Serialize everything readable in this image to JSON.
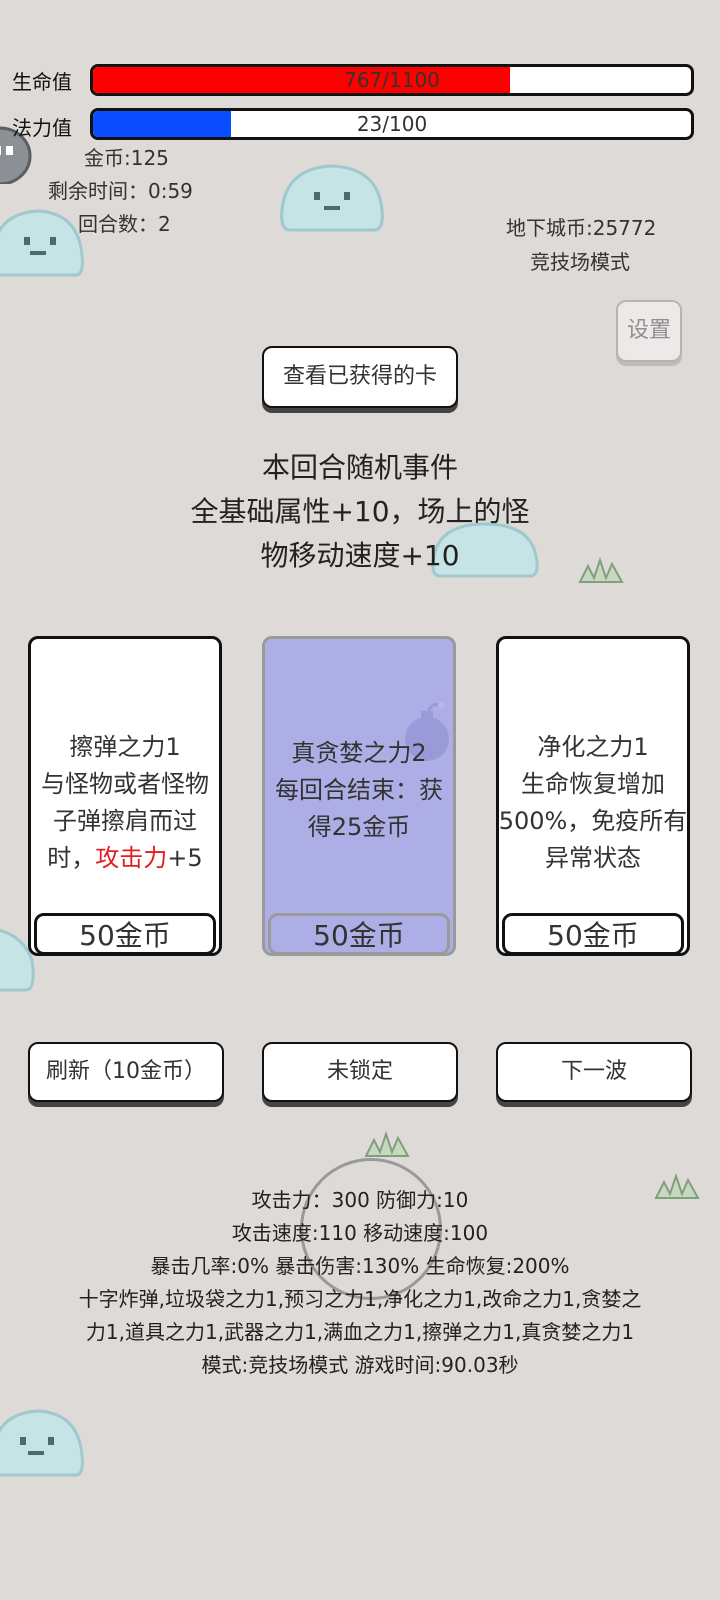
{
  "hud": {
    "hp_label": "生命值",
    "hp_text": "767/1100",
    "hp_fraction": 0.697,
    "mp_label": "法力值",
    "mp_text": "23/100",
    "mp_fraction": 0.23,
    "gold": "金币:125",
    "time_left": "剩余时间：0:59",
    "round": "回合数：2",
    "dungeon_coin": "地下城币:25772",
    "mode": "竞技场模式",
    "settings_label": "设置"
  },
  "view_cards_label": "查看已获得的卡",
  "event": {
    "line1": "本回合随机事件",
    "line2": "全基础属性+10，场上的怪",
    "line3": "物移动速度+10"
  },
  "cards": [
    {
      "lines": [
        "擦弹之力1",
        "与怪物或者怪物",
        "子弹擦肩而过"
      ],
      "last_prefix": "时，",
      "last_highlight": "攻击力",
      "last_suffix": "+5",
      "price": "50金币"
    },
    {
      "lines": [
        "真贪婪之力2",
        "每回合结束：获",
        "得25金币"
      ],
      "price": "50金币"
    },
    {
      "lines": [
        "净化之力1",
        "生命恢复增加",
        "500%，免疫所有",
        "异常状态"
      ],
      "price": "50金币"
    }
  ],
  "actions": {
    "refresh": "刷新（10金币）",
    "lock": "未锁定",
    "next": "下一波"
  },
  "stats": {
    "line1": "攻击力：300 防御力:10",
    "line2": "攻击速度:110 移动速度:100",
    "line3": "暴击几率:0% 暴击伤害:130% 生命恢复:200%",
    "line4": "十字炸弹,垃圾袋之力1,预习之力1,净化之力1,改命之力1,贪婪之",
    "line5": "力1,道具之力1,武器之力1,满血之力1,擦弹之力1,真贪婪之力1",
    "line6": "模式:竞技场模式 游戏时间:90.03秒"
  },
  "colors": {
    "hp": "#ff0000",
    "mp": "#0a4cff",
    "selected_card": "#aeaee6",
    "highlight": "#e02020",
    "background": "#dedad7"
  }
}
